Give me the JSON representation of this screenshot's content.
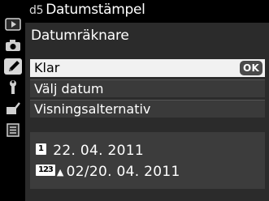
{
  "header": {
    "code": "d5",
    "title": "Datumstämpel"
  },
  "subtitle": "Datumräknare",
  "menu": {
    "items": [
      {
        "label": "Klar",
        "badge": "OK"
      },
      {
        "label": "Välj datum"
      },
      {
        "label": "Visningsalternativ"
      }
    ]
  },
  "info": {
    "line1": {
      "marker": "1",
      "date": "22. 04. 2011"
    },
    "line2": {
      "marker": "123",
      "arrow": "▲",
      "date": "02/20. 04. 2011"
    }
  },
  "sidebar": {
    "icons": [
      "playback-icon",
      "camera-icon",
      "pencil-icon",
      "wrench-icon",
      "retouch-icon",
      "my-menu-icon"
    ],
    "active": "pencil-icon"
  }
}
